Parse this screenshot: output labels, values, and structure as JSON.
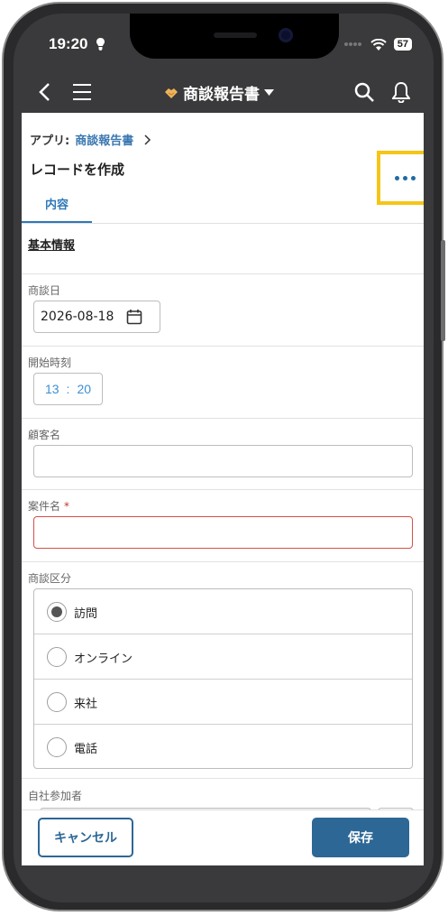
{
  "status_bar": {
    "time": "19:20",
    "battery": "57"
  },
  "header": {
    "title": "商談報告書"
  },
  "breadcrumb": {
    "prefix": "アプリ:",
    "app_link": "商談報告書"
  },
  "page": {
    "title": "レコードを作成"
  },
  "tabs": [
    {
      "label": "内容"
    }
  ],
  "form": {
    "section_title": "基本情報",
    "date_label": "商談日",
    "date_value": "2026-08-18",
    "time_label": "開始時刻",
    "time_hour": "13",
    "time_sep": ":",
    "time_minute": "20",
    "customer_label": "顧客名",
    "customer_value": "",
    "case_label": "案件名",
    "case_required_mark": "*",
    "case_value": "",
    "type_label": "商談区分",
    "type_options": [
      "訪問",
      "オンライン",
      "来社",
      "電話"
    ],
    "type_selected": "訪問",
    "participants_label": "自社参加者"
  },
  "footer": {
    "cancel_label": "キャンセル",
    "save_label": "保存"
  },
  "colors": {
    "header_bg": "#3a3a3c",
    "accent": "#2d6796",
    "link": "#3b78b0",
    "highlight": "#f5c518",
    "error": "#d3504a"
  }
}
